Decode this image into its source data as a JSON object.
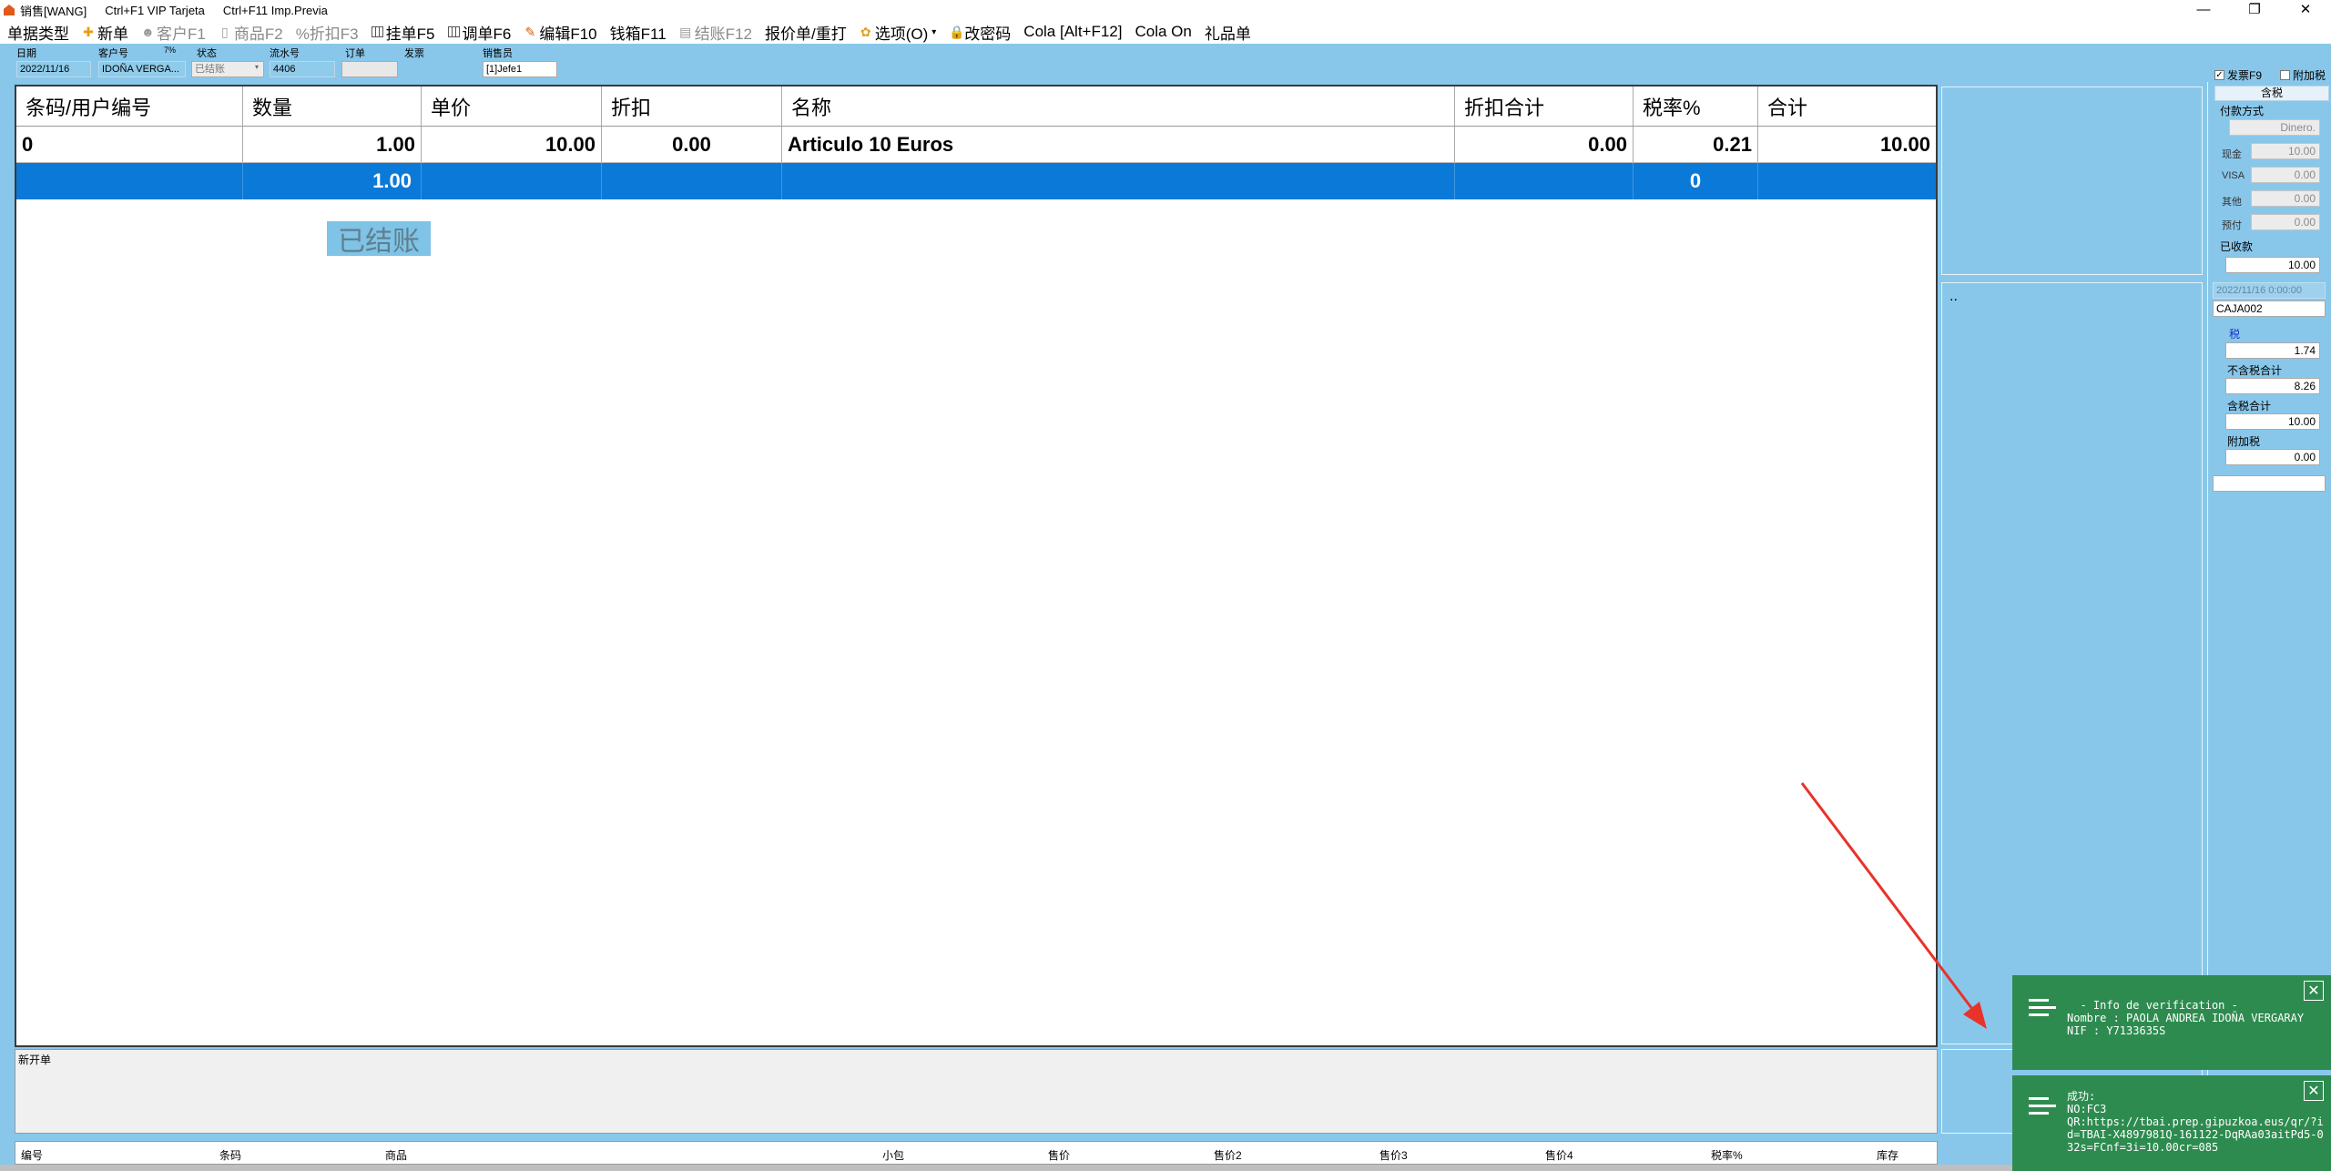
{
  "window": {
    "title": "销售[WANG]",
    "hint1": "Ctrl+F1 VIP Tarjeta",
    "hint2": "Ctrl+F11 Imp.Previa",
    "minimize": "—",
    "restore": "❐",
    "close": "✕"
  },
  "menu": {
    "doc_type": "单据类型",
    "new": "新单",
    "customer": "客户F1",
    "product": "商品F2",
    "discount": "%折扣F3",
    "hold": "挂单F5",
    "adjust": "调单F6",
    "edit": "编辑F10",
    "cashbox": "钱箱F11",
    "checkout": "结账F12",
    "quote": "报价单/重打",
    "options": "选项(O)",
    "change_password": "改密码",
    "cola": "Cola [Alt+F12]",
    "cola_on": "Cola On",
    "gift": "礼品单"
  },
  "header": {
    "date_label": "日期",
    "date_value": "2022/11/16",
    "customer_label": "客户号",
    "customer_pct": "7%",
    "customer_value": "IDOÑA VERGA...",
    "status_label": "状态",
    "status_value": "已结账",
    "serial_label": "流水号",
    "serial_value": "4406",
    "order_label": "订单",
    "order_value": "",
    "invoice_label": "发票",
    "seller_label": "销售员",
    "seller_value": "[1]Jefe1"
  },
  "grid": {
    "columns": [
      "条码/用户编号",
      "数量",
      "单价",
      "折扣",
      "名称",
      "折扣合计",
      "税率%",
      "合计"
    ],
    "rows": [
      [
        "0",
        "1.00",
        "10.00",
        "0.00",
        "Articulo 10 Euros",
        "0.00",
        "0.21",
        "10.00"
      ]
    ],
    "summary": {
      "qty": "1.00",
      "tax": "0"
    },
    "status_overlay": "已结账"
  },
  "notes": {
    "label": "新开单"
  },
  "product_list": {
    "columns": [
      "编号",
      "条码",
      "商品",
      "小包",
      "售价",
      "售价2",
      "售价3",
      "售价4",
      "税率%",
      "库存"
    ]
  },
  "midpanel": {
    "dots": ".."
  },
  "sidebar": {
    "invoice_check": "发票F9",
    "surcharge_check": "附加税",
    "tax_tab": "含税",
    "payment_method_label": "付款方式",
    "payment_method_value": "Dinero.",
    "cash_label": "现金",
    "cash_value": "10.00",
    "visa_label": "VISA",
    "visa_value": "0.00",
    "other_label": "其他",
    "other_value": "0.00",
    "prepaid_label": "预付",
    "prepaid_value": "0.00",
    "received_label": "已收款",
    "received_value": "10.00",
    "datetime_value": "2022/11/16 0:00:00",
    "register_value": "CAJA002",
    "tax_label": "税",
    "tax_value": "1.74",
    "pretax_label": "不含税合计",
    "pretax_value": "8.26",
    "total_label": "含税合计",
    "total_value": "10.00",
    "surcharge_label": "附加税",
    "surcharge_value": "0.00"
  },
  "toasts": {
    "verify": {
      "line1": "  - Info de verification -",
      "line2": "Nombre : PAOLA ANDREA IDOÑA VERGARAY",
      "line3": "NIF : Y7133635S"
    },
    "success": {
      "line1": "成功:",
      "line2": "NO:FC3",
      "line3": "QR:https://tbai.prep.gipuzkoa.eus/qr/?i",
      "line4": "d=TBAI-X4897981Q-161122-DqRAa03aitPd5-0",
      "line5": "32s=FCnf=3i=10.00cr=085"
    }
  },
  "colors": {
    "background": "#89c7ea",
    "selected_row": "#0b79d8",
    "toast": "#2e8b4f",
    "arrow": "#e8332a"
  }
}
